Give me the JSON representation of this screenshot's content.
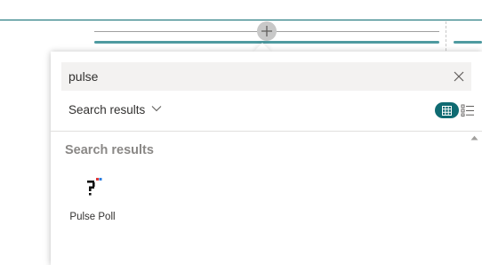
{
  "canvas": {
    "add_section_icon": "plus-icon"
  },
  "picker": {
    "search": {
      "value": "pulse",
      "placeholder": "",
      "clear_icon": "close-icon"
    },
    "filter": {
      "label": "Search results",
      "icon": "chevron-down-icon"
    },
    "view_toggle": {
      "grid_icon": "grid-icon",
      "list_icon": "list-icon",
      "active": "grid"
    },
    "results": {
      "heading": "Search results",
      "items": [
        {
          "label": "Pulse Poll",
          "icon": "pulse-poll-icon"
        }
      ]
    }
  },
  "colors": {
    "accent": "#0f6b72",
    "theme_band": "#4e9aa0",
    "top_rule": "#0a6a6f",
    "search_bg": "#f3f2f1",
    "heading_gray": "#8a8886",
    "icon_red": "#e03a3a",
    "icon_blue": "#2a7de1"
  }
}
